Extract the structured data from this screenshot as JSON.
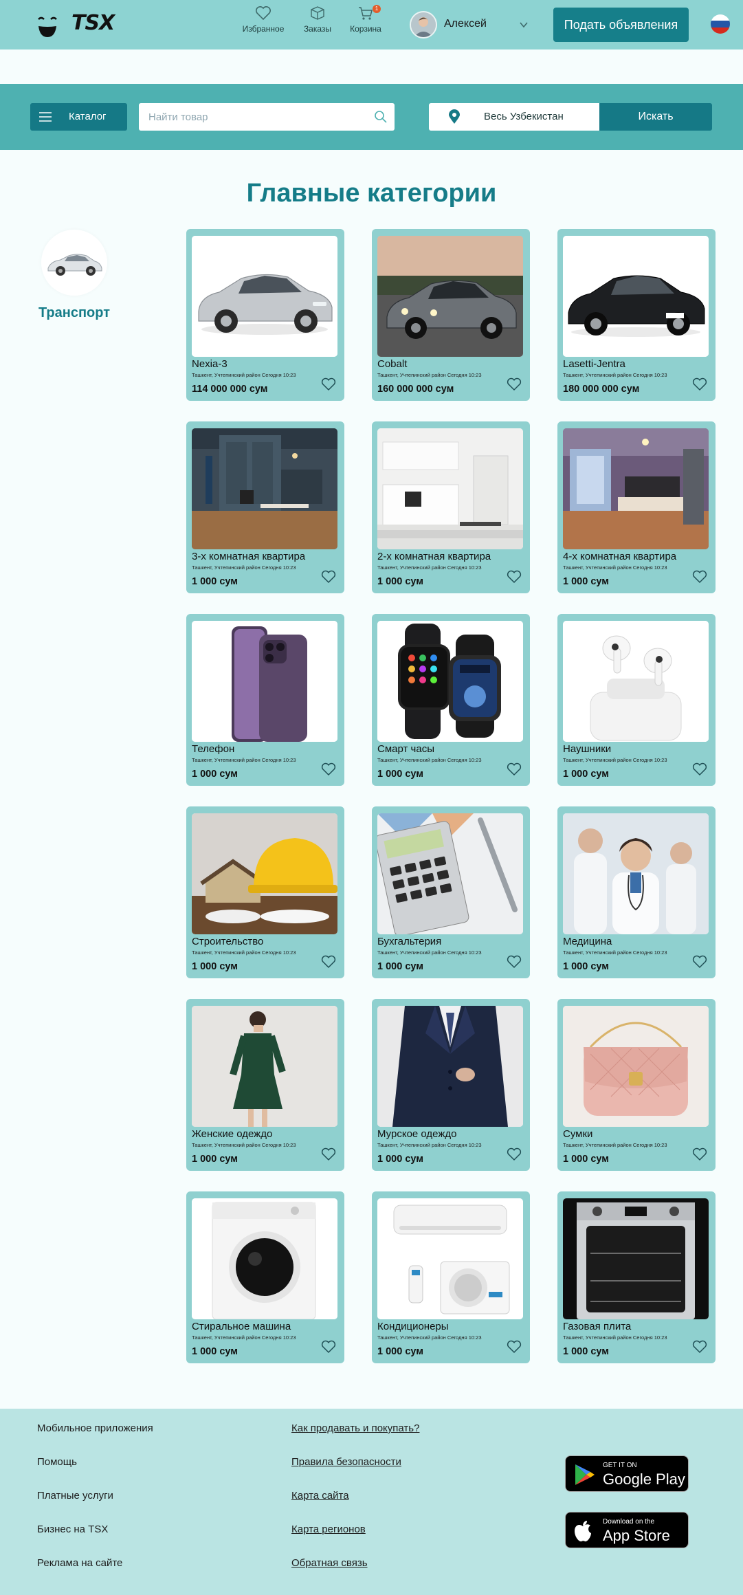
{
  "header": {
    "logo_text": "TSX",
    "nav": [
      {
        "label": "Избранное",
        "icon": "heart-icon"
      },
      {
        "label": "Заказы",
        "icon": "box-icon"
      },
      {
        "label": "Корзина",
        "icon": "cart-icon",
        "badge": "1"
      }
    ],
    "user_name": "Алексей",
    "post_button": "Подать объявления",
    "language_flag": "russia-flag-icon"
  },
  "search": {
    "catalog_label": "Каталог",
    "placeholder": "Найти товар",
    "region": "Весь Узбекистан",
    "search_button": "Искать"
  },
  "main": {
    "title": "Главные категории",
    "side_category": "Транспорт",
    "products": [
      {
        "title": "Nexia-3",
        "meta": "Ташкент, Учтепинский район Сегодня 10:23",
        "price": "114 000 000 сум",
        "image": "silver-sedan"
      },
      {
        "title": "Cobalt",
        "meta": "Ташкент, Учтепинский район Сегодня 10:23",
        "price": "160 000 000 сум",
        "image": "grey-sedan"
      },
      {
        "title": "Lasetti-Jentra",
        "meta": "Ташкент, Учтепинский район Сегодня 10:23",
        "price": "180 000 000 сум",
        "image": "black-sedan"
      },
      {
        "title": "3-х комнатная квартира",
        "meta": "Ташкент, Учтепинский район Сегодня 10:23",
        "price": "1 000 сум",
        "image": "dark-kitchen"
      },
      {
        "title": "2-х комнатная квартира",
        "meta": "Ташкент, Учтепинский район Сегодня 10:23",
        "price": "1 000 сум",
        "image": "white-kitchen"
      },
      {
        "title": "4-х комнатная квартира",
        "meta": "Ташкент, Учтепинский район Сегодня 10:23",
        "price": "1 000 сум",
        "image": "living-room"
      },
      {
        "title": "Телефон",
        "meta": "Ташкент, Учтепинский район Сегодня 10:23",
        "price": "1 000 сум",
        "image": "phone"
      },
      {
        "title": "Смарт часы",
        "meta": "Ташкент, Учтепинский район Сегодня 10:23",
        "price": "1 000 сум",
        "image": "smartwatch"
      },
      {
        "title": "Наушники",
        "meta": "Ташкент, Учтепинский район Сегодня 10:23",
        "price": "1 000 сум",
        "image": "earbuds"
      },
      {
        "title": "Строительство",
        "meta": "Ташкент, Учтепинский район Сегодня 10:23",
        "price": "1 000 сум",
        "image": "hardhat"
      },
      {
        "title": "Бухгальтерия",
        "meta": "Ташкент, Учтепинский район Сегодня 10:23",
        "price": "1 000 сум",
        "image": "calculator"
      },
      {
        "title": "Медицина",
        "meta": "Ташкент, Учтепинский район Сегодня 10:23",
        "price": "1 000 сум",
        "image": "doctors"
      },
      {
        "title": "Женские одеждо",
        "meta": "Ташкент, Учтепинский район Сегодня 10:23",
        "price": "1 000 сум",
        "image": "green-dress"
      },
      {
        "title": "Мурское одеждо",
        "meta": "Ташкент, Учтепинский район Сегодня 10:23",
        "price": "1 000 сум",
        "image": "suit"
      },
      {
        "title": "Сумки",
        "meta": "Ташкент, Учтепинский район Сегодня 10:23",
        "price": "1 000 сум",
        "image": "pink-bag"
      },
      {
        "title": "Стиральное машина",
        "meta": "Ташкент, Учтепинский район Сегодня 10:23",
        "price": "1 000 сум",
        "image": "washing-machine"
      },
      {
        "title": "Кондиционеры",
        "meta": "Ташкент, Учтепинский район Сегодня 10:23",
        "price": "1 000 сум",
        "image": "air-conditioner"
      },
      {
        "title": "Газовая плита",
        "meta": "Ташкент, Учтепинский район Сегодня 10:23",
        "price": "1 000 сум",
        "image": "oven"
      }
    ]
  },
  "footer": {
    "col1": [
      "Мобильное приложения",
      "Помощь",
      "Платные услуги",
      "Бизнес на TSX",
      "Реклама на сайте"
    ],
    "col2": [
      "Как продавать и покупать?",
      "Правила безопасности",
      "Карта сайта",
      "Карта регионов",
      "Обратная связь"
    ],
    "google_play": {
      "small": "GET IT ON",
      "big": "Google Play"
    },
    "app_store": {
      "small": "Download on the",
      "big": "App Store"
    }
  },
  "colors": {
    "header_bg": "#8dd3d2",
    "search_bg": "#4eb1b1",
    "accent": "#157986",
    "card_bg": "#8fd0cf",
    "footer_bg": "#bae4e3"
  }
}
